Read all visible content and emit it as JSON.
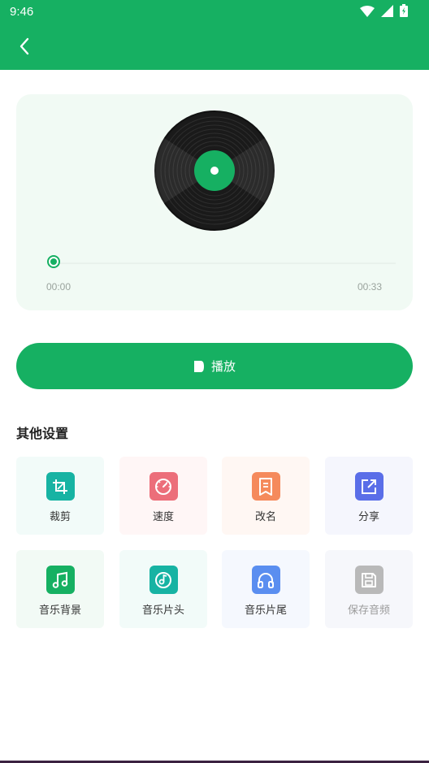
{
  "status_bar": {
    "time": "9:46"
  },
  "player": {
    "current_time": "00:00",
    "total_time": "00:33",
    "progress": 0
  },
  "play_button": {
    "label": "播放"
  },
  "settings": {
    "title": "其他设置",
    "items": [
      {
        "label": "裁剪",
        "icon": "crop-icon",
        "color": "#17b3a3",
        "bg": "#f2fbf9"
      },
      {
        "label": "速度",
        "icon": "speedometer-icon",
        "color": "#ec6e7a",
        "bg": "#fff6f6"
      },
      {
        "label": "改名",
        "icon": "rename-icon",
        "color": "#f58a5c",
        "bg": "#fff7f3"
      },
      {
        "label": "分享",
        "icon": "share-icon",
        "color": "#5a6ee8",
        "bg": "#f5f6fd"
      },
      {
        "label": "音乐背景",
        "icon": "music-note-icon",
        "color": "#16b062",
        "bg": "#f2faf5"
      },
      {
        "label": "音乐片头",
        "icon": "music-disc-icon",
        "color": "#17b3a3",
        "bg": "#f2fbf9"
      },
      {
        "label": "音乐片尾",
        "icon": "headphones-icon",
        "color": "#5a8ef0",
        "bg": "#f5f8fe"
      },
      {
        "label": "保存音频",
        "icon": "save-icon",
        "color": "#b9b9b9",
        "bg": "#f6f7fb",
        "disabled": true
      }
    ]
  },
  "colors": {
    "primary": "#16b062",
    "card_bg": "#f1faf4"
  }
}
